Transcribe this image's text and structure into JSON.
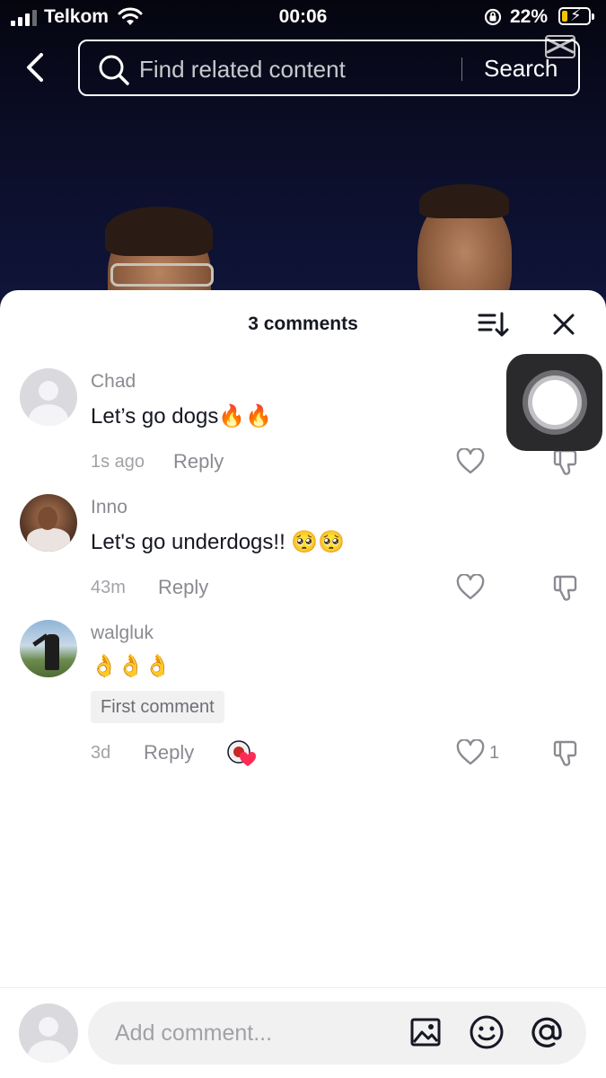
{
  "status_bar": {
    "carrier": "Telkom",
    "time": "00:06",
    "battery_percent": "22%",
    "battery_level": 0.22,
    "battery_fill_color": "#f5c400"
  },
  "search": {
    "placeholder": "Find related content",
    "button_label": "Search"
  },
  "sheet": {
    "title": "3 comments"
  },
  "comments": [
    {
      "username": "Chad",
      "text": "Let’s go dogs🔥🔥",
      "time": "1s ago",
      "reply_label": "Reply",
      "like_count": ""
    },
    {
      "username": "Inno",
      "text": "Let's go underdogs!! 🥺🥺",
      "time": "43m",
      "reply_label": "Reply",
      "like_count": ""
    },
    {
      "username": "walgluk",
      "text": "👌👌👌",
      "badge": "First comment",
      "time": "3d",
      "reply_label": "Reply",
      "like_count": "1"
    }
  ],
  "composer": {
    "placeholder": "Add comment..."
  },
  "icons": {
    "back": "chevron-left-icon",
    "search": "search-icon",
    "sort": "sort-icon",
    "close": "close-icon",
    "like": "heart-outline-icon",
    "dislike": "thumbs-down-icon",
    "image": "image-icon",
    "emoji": "emoji-icon",
    "mention": "at-sign-icon"
  },
  "colors": {
    "text_primary": "#161823",
    "text_secondary": "#8a8b91",
    "liked_heart": "#fe2c55"
  }
}
